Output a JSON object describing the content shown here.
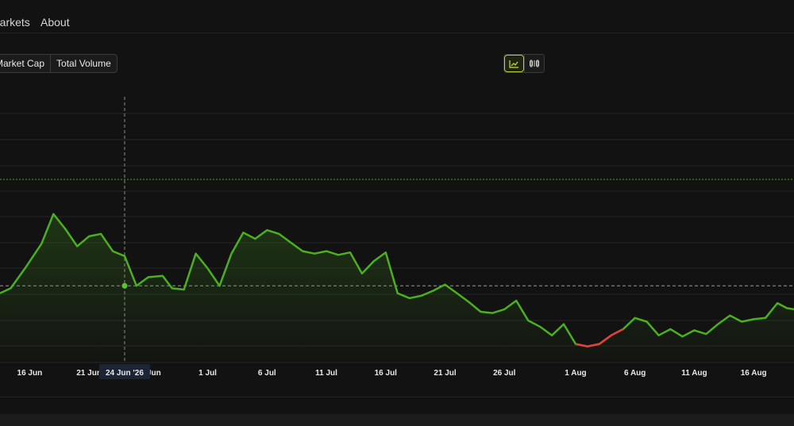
{
  "nav": {
    "items": [
      {
        "label": "Markets"
      },
      {
        "label": "About"
      }
    ]
  },
  "metric_toggle": {
    "options": [
      "Market Cap",
      "Total Volume"
    ]
  },
  "chart_type_toggle": {
    "options": [
      {
        "icon": "line-chart-icon",
        "active": true
      },
      {
        "icon": "candlestick-chart-icon",
        "active": false
      }
    ]
  },
  "colors": {
    "background": "#121212",
    "line_up": "#4caf1f",
    "line_down": "#e53e3e",
    "grid": "#252525",
    "reference_line": "#5a9c2a",
    "accent": "#b6d33a"
  },
  "chart_data": {
    "type": "area",
    "x_tick_labels": [
      "16 Jun",
      "21 Jun",
      "26 Jun",
      "1 Jul",
      "6 Jul",
      "11 Jul",
      "16 Jul",
      "21 Jul",
      "26 Jul",
      "1 Aug",
      "6 Aug",
      "11 Aug",
      "16 Aug"
    ],
    "x_tick_days": [
      0,
      5,
      10,
      15,
      20,
      25,
      30,
      35,
      40,
      46,
      51,
      56,
      61
    ],
    "x_range_days": [
      -2.5,
      64.4
    ],
    "y_range": [
      0,
      100
    ],
    "y_axis_labels_visible": false,
    "grid_lines": true,
    "high_reference": 74,
    "baseline_reference": 31,
    "crosshair": {
      "label": "24 Jun '26",
      "day": 8.0,
      "value": 31.0
    },
    "series": [
      {
        "x_days": [
          -2.5,
          -1.6,
          -0.4,
          1.0,
          2.0,
          3.0,
          4.0,
          5.0,
          6.0,
          7.0,
          8.0,
          9.0,
          10.0,
          11.2,
          12.0,
          13.0,
          14.0,
          15.0,
          16.0,
          17.0,
          18.0,
          19.0,
          20.0,
          21.0,
          22.0,
          23.0,
          24.0,
          25.0,
          26.0,
          27.0,
          28.0,
          29.0,
          30.0,
          31.0,
          32.0,
          33.0,
          34.0,
          35.0,
          36.0,
          37.0,
          38.0,
          39.0,
          40.0,
          41.0,
          42.0,
          43.0,
          44.0,
          45.0,
          46.0,
          47.0,
          48.0,
          49.0,
          50.0,
          51.0,
          52.0,
          53.0,
          54.0,
          55.0,
          56.0,
          57.0,
          58.0,
          59.0,
          60.0,
          61.0,
          62.0,
          63.0,
          63.8,
          64.4
        ],
        "values": [
          28,
          30,
          38,
          48,
          60,
          54,
          47,
          51,
          52,
          45,
          43,
          31,
          34.5,
          35,
          30,
          29.5,
          44,
          38,
          31,
          44,
          52.5,
          50,
          53.5,
          52,
          48.5,
          45,
          44,
          45,
          43.5,
          44.5,
          36,
          41,
          44.5,
          28,
          26,
          27,
          29,
          31.5,
          28,
          24.5,
          20.5,
          20,
          21.5,
          25,
          17,
          14.5,
          11,
          15.5,
          7.5,
          6.5,
          7.5,
          11,
          13.5,
          18,
          16.5,
          11,
          13.5,
          10.5,
          13,
          11.5,
          15.5,
          19,
          16.5,
          17.5,
          18,
          24,
          22,
          21.5
        ],
        "down_segment_days": [
          46.0,
          50.0
        ]
      }
    ]
  }
}
